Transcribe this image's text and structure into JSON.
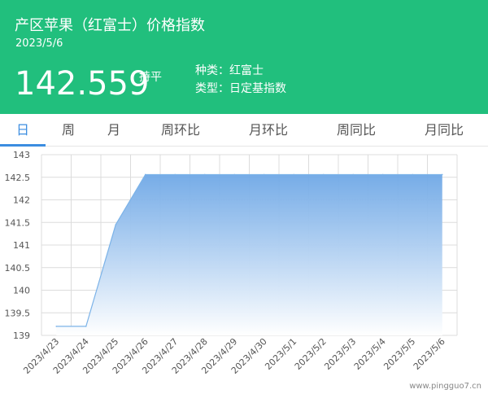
{
  "header": {
    "title": "产区苹果（红富士）价格指数",
    "date": "2023/5/6",
    "price": "142.559",
    "trend": "持平",
    "category": "种类：红富士",
    "type": "类型：日定基指数",
    "background_color": "#21bf7d"
  },
  "tabs": [
    {
      "label": "日",
      "active": true
    },
    {
      "label": "周",
      "active": false
    },
    {
      "label": "月",
      "active": false
    },
    {
      "label": "周环比",
      "active": false
    },
    {
      "label": "月环比",
      "active": false
    },
    {
      "label": "周同比",
      "active": false
    },
    {
      "label": "月同比",
      "active": false
    }
  ],
  "accent_color": "#3b8de0",
  "chart_data": {
    "type": "area",
    "title": "",
    "xlabel": "",
    "ylabel": "",
    "ylim": [
      139,
      143
    ],
    "yticks": [
      "139",
      "139.5",
      "140",
      "140.5",
      "141",
      "141.5",
      "142",
      "142.5",
      "143"
    ],
    "categories": [
      "2023/4/23",
      "2023/4/24",
      "2023/4/25",
      "2023/4/26",
      "2023/4/27",
      "2023/4/28",
      "2023/4/29",
      "2023/4/30",
      "2023/5/1",
      "2023/5/2",
      "2023/5/3",
      "2023/5/4",
      "2023/5/5",
      "2023/5/6"
    ],
    "series": [
      {
        "values": [
          139.2,
          139.2,
          141.45,
          142.559,
          142.559,
          142.559,
          142.559,
          142.559,
          142.559,
          142.559,
          142.559,
          142.559,
          142.559,
          142.559
        ]
      }
    ],
    "grid": true,
    "line_color": "#7cb3e8",
    "fill_top_color": "#6fa8e6",
    "fill_bottom_color": "#ffffff"
  },
  "watermark": "www.pingguo7.cn"
}
